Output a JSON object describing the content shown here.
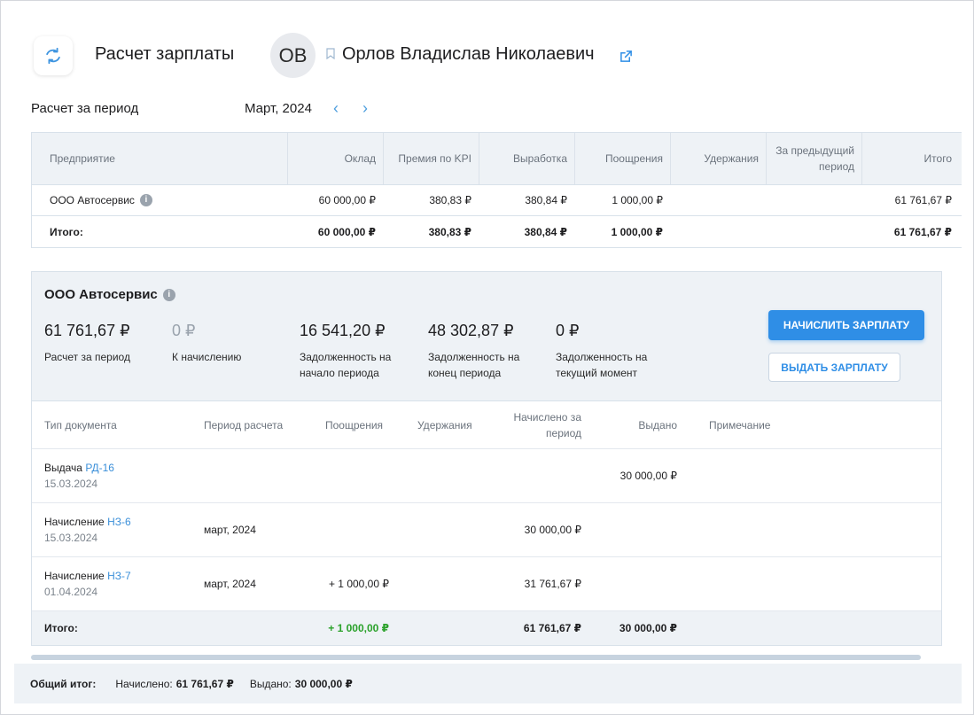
{
  "header": {
    "title": "Расчет зарплаты",
    "avatar_initials": "ОВ",
    "employee_name": "Орлов Владислав Николаевич"
  },
  "period": {
    "label": "Расчет за период",
    "value": "Март, 2024"
  },
  "summary": {
    "columns": [
      "Предприятие",
      "Оклад",
      "Премия по KPI",
      "Выработка",
      "Поощрения",
      "Удержания",
      "За предыдущий период",
      "Итого"
    ],
    "rows": [
      {
        "company": "ООО Автосервис",
        "salary": "60 000,00 ₽",
        "kpi": "380,83 ₽",
        "output": "380,84 ₽",
        "bonus": "1 000,00 ₽",
        "deductions": "",
        "previous": "",
        "total": "61 761,67 ₽"
      }
    ],
    "total": {
      "label": "Итого:",
      "salary": "60 000,00 ₽",
      "kpi": "380,83 ₽",
      "output": "380,84 ₽",
      "bonus": "1 000,00 ₽",
      "deductions": "",
      "previous": "",
      "total": "61 761,67 ₽"
    }
  },
  "company": {
    "title": "ООО Автосервис",
    "stats": [
      {
        "value": "61 761,67 ₽",
        "label": "Расчет за период"
      },
      {
        "value": "0 ₽",
        "label": "К начислению"
      },
      {
        "value": "16 541,20 ₽",
        "label": "Задолженность на начало периода"
      },
      {
        "value": "48 302,87 ₽",
        "label": "Задолженность на конец периода"
      },
      {
        "value": "0 ₽",
        "label": "Задолженность на текущий момент"
      }
    ],
    "buttons": {
      "accrue": "НАЧИСЛИТЬ ЗАРПЛАТУ",
      "pay": "ВЫДАТЬ ЗАРПЛАТУ"
    },
    "doc_columns": [
      "Тип документа",
      "Период расчета",
      "Поощрения",
      "Удержания",
      "Начислено за период",
      "Выдано",
      "Примечание"
    ],
    "docs": [
      {
        "type": "Выдача",
        "number": "РД-16",
        "date": "15.03.2024",
        "period": "",
        "bonus": "",
        "deductions": "",
        "accrued": "",
        "paid": "30 000,00 ₽",
        "note": ""
      },
      {
        "type": "Начисление",
        "number": "НЗ-6",
        "date": "15.03.2024",
        "period": "март, 2024",
        "bonus": "",
        "deductions": "",
        "accrued": "30 000,00 ₽",
        "paid": "",
        "note": ""
      },
      {
        "type": "Начисление",
        "number": "НЗ-7",
        "date": "01.04.2024",
        "period": "март, 2024",
        "bonus": "+ 1 000,00 ₽",
        "deductions": "",
        "accrued": "31 761,67 ₽",
        "paid": "",
        "note": ""
      }
    ],
    "doc_total": {
      "label": "Итого:",
      "bonus": "+ 1 000,00 ₽",
      "accrued": "61 761,67 ₽",
      "paid": "30 000,00 ₽"
    }
  },
  "footer": {
    "label": "Общий итог:",
    "accrued_label": "Начислено:",
    "accrued_value": "61 761,67 ₽",
    "paid_label": "Выдано:",
    "paid_value": "30 000,00 ₽"
  },
  "icons": {
    "app": "refresh-icon",
    "bookmark": "bookmark-icon",
    "external": "external-link-icon",
    "info": "info-icon",
    "prev": "chevron-left-icon",
    "next": "chevron-right-icon"
  },
  "colors": {
    "accent": "#2f8ee6",
    "positive": "#2aa12a",
    "panel": "#eef2f6"
  }
}
